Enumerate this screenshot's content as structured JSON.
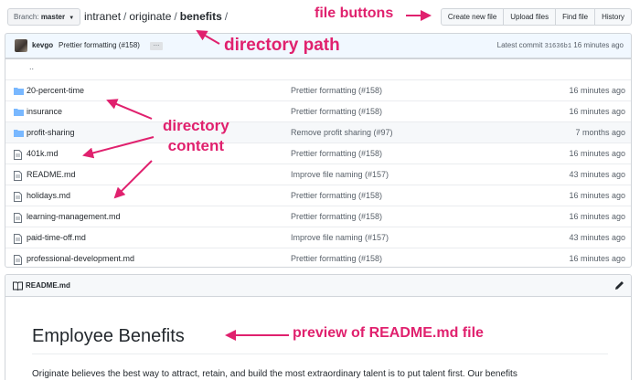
{
  "branch": {
    "label": "Branch:",
    "value": "master"
  },
  "breadcrumb": {
    "parts": [
      "intranet",
      "originate"
    ],
    "current": "benefits",
    "sep": "/"
  },
  "file_buttons": [
    "Create new file",
    "Upload files",
    "Find file",
    "History"
  ],
  "commit": {
    "author": "kevgo",
    "message": "Prettier formatting (#158)",
    "ellipsis": "…",
    "latest_label": "Latest commit",
    "sha": "31636b1",
    "age": "16 minutes ago"
  },
  "files": [
    {
      "type": "up",
      "name": ".."
    },
    {
      "type": "dir",
      "name": "20-percent-time",
      "message": "Prettier formatting (#158)",
      "age": "16 minutes ago"
    },
    {
      "type": "dir",
      "name": "insurance",
      "message": "Prettier formatting (#158)",
      "age": "16 minutes ago"
    },
    {
      "type": "dir",
      "name": "profit-sharing",
      "message": "Remove profit sharing (#97)",
      "age": "7 months ago"
    },
    {
      "type": "file",
      "name": "401k.md",
      "message": "Prettier formatting (#158)",
      "age": "16 minutes ago"
    },
    {
      "type": "file",
      "name": "README.md",
      "message": "Improve file naming (#157)",
      "age": "43 minutes ago"
    },
    {
      "type": "file",
      "name": "holidays.md",
      "message": "Prettier formatting (#158)",
      "age": "16 minutes ago"
    },
    {
      "type": "file",
      "name": "learning-management.md",
      "message": "Prettier formatting (#158)",
      "age": "16 minutes ago"
    },
    {
      "type": "file",
      "name": "paid-time-off.md",
      "message": "Improve file naming (#157)",
      "age": "43 minutes ago"
    },
    {
      "type": "file",
      "name": "professional-development.md",
      "message": "Prettier formatting (#158)",
      "age": "16 minutes ago"
    }
  ],
  "readme": {
    "filename": "README.md",
    "heading": "Employee Benefits",
    "paragraph": "Originate believes the best way to attract, retain, and build the most extraordinary talent is to put talent first. Our benefits"
  },
  "annotations": {
    "file_buttons": "file buttons",
    "directory_path": "directory path",
    "directory_content_line1": "directory",
    "directory_content_line2": "content",
    "preview": "preview of README.md file"
  },
  "colors": {
    "annotation": "#e0216e",
    "icon_folder": "#79b8ff",
    "icon_file": "#6a737d",
    "commit_bar_bg": "#f1f8ff",
    "row_shade": "#f6f8fa"
  },
  "icons": {
    "dir": "folder-icon",
    "file": "file-icon",
    "readme": "book-icon",
    "edit": "pencil-icon"
  }
}
